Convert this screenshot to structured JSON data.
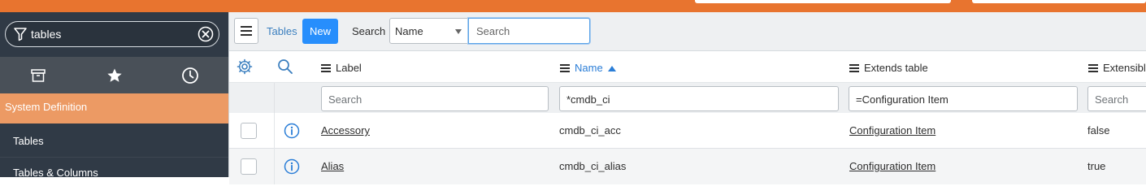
{
  "nav": {
    "filter_value": "tables",
    "tabs": [
      {
        "icon": "archive-icon"
      },
      {
        "icon": "star-icon"
      },
      {
        "icon": "clock-icon"
      }
    ],
    "section": "System Definition",
    "items": [
      "Tables",
      "Tables & Columns"
    ]
  },
  "toolbar": {
    "title": "Tables",
    "new_label": "New",
    "search_label": "Search",
    "field_select_value": "Name",
    "search_placeholder": "Search"
  },
  "columns": [
    {
      "label": "Label",
      "sorted": false
    },
    {
      "label": "Name",
      "sorted": true,
      "sort_dir": "ascending"
    },
    {
      "label": "Extends table",
      "sorted": false
    },
    {
      "label": "Extensible",
      "sorted": false
    }
  ],
  "column_filters": [
    {
      "value": "",
      "placeholder": "Search"
    },
    {
      "value": "*cmdb_ci",
      "placeholder": ""
    },
    {
      "value": "=Configuration Item",
      "placeholder": ""
    },
    {
      "value": "",
      "placeholder": "Search"
    }
  ],
  "rows": [
    {
      "label": "Accessory",
      "name": "cmdb_ci_acc",
      "extends": "Configuration Item",
      "extensible": "false"
    },
    {
      "label": "Alias",
      "name": "cmdb_ci_alias",
      "extends": "Configuration Item",
      "extensible": "true"
    }
  ],
  "colors": {
    "accent_orange": "#e8742f",
    "section_orange": "#ec9a64",
    "nav_bg": "#303a46",
    "primary_blue": "#278efc",
    "link_blue": "#2b7ed7"
  }
}
